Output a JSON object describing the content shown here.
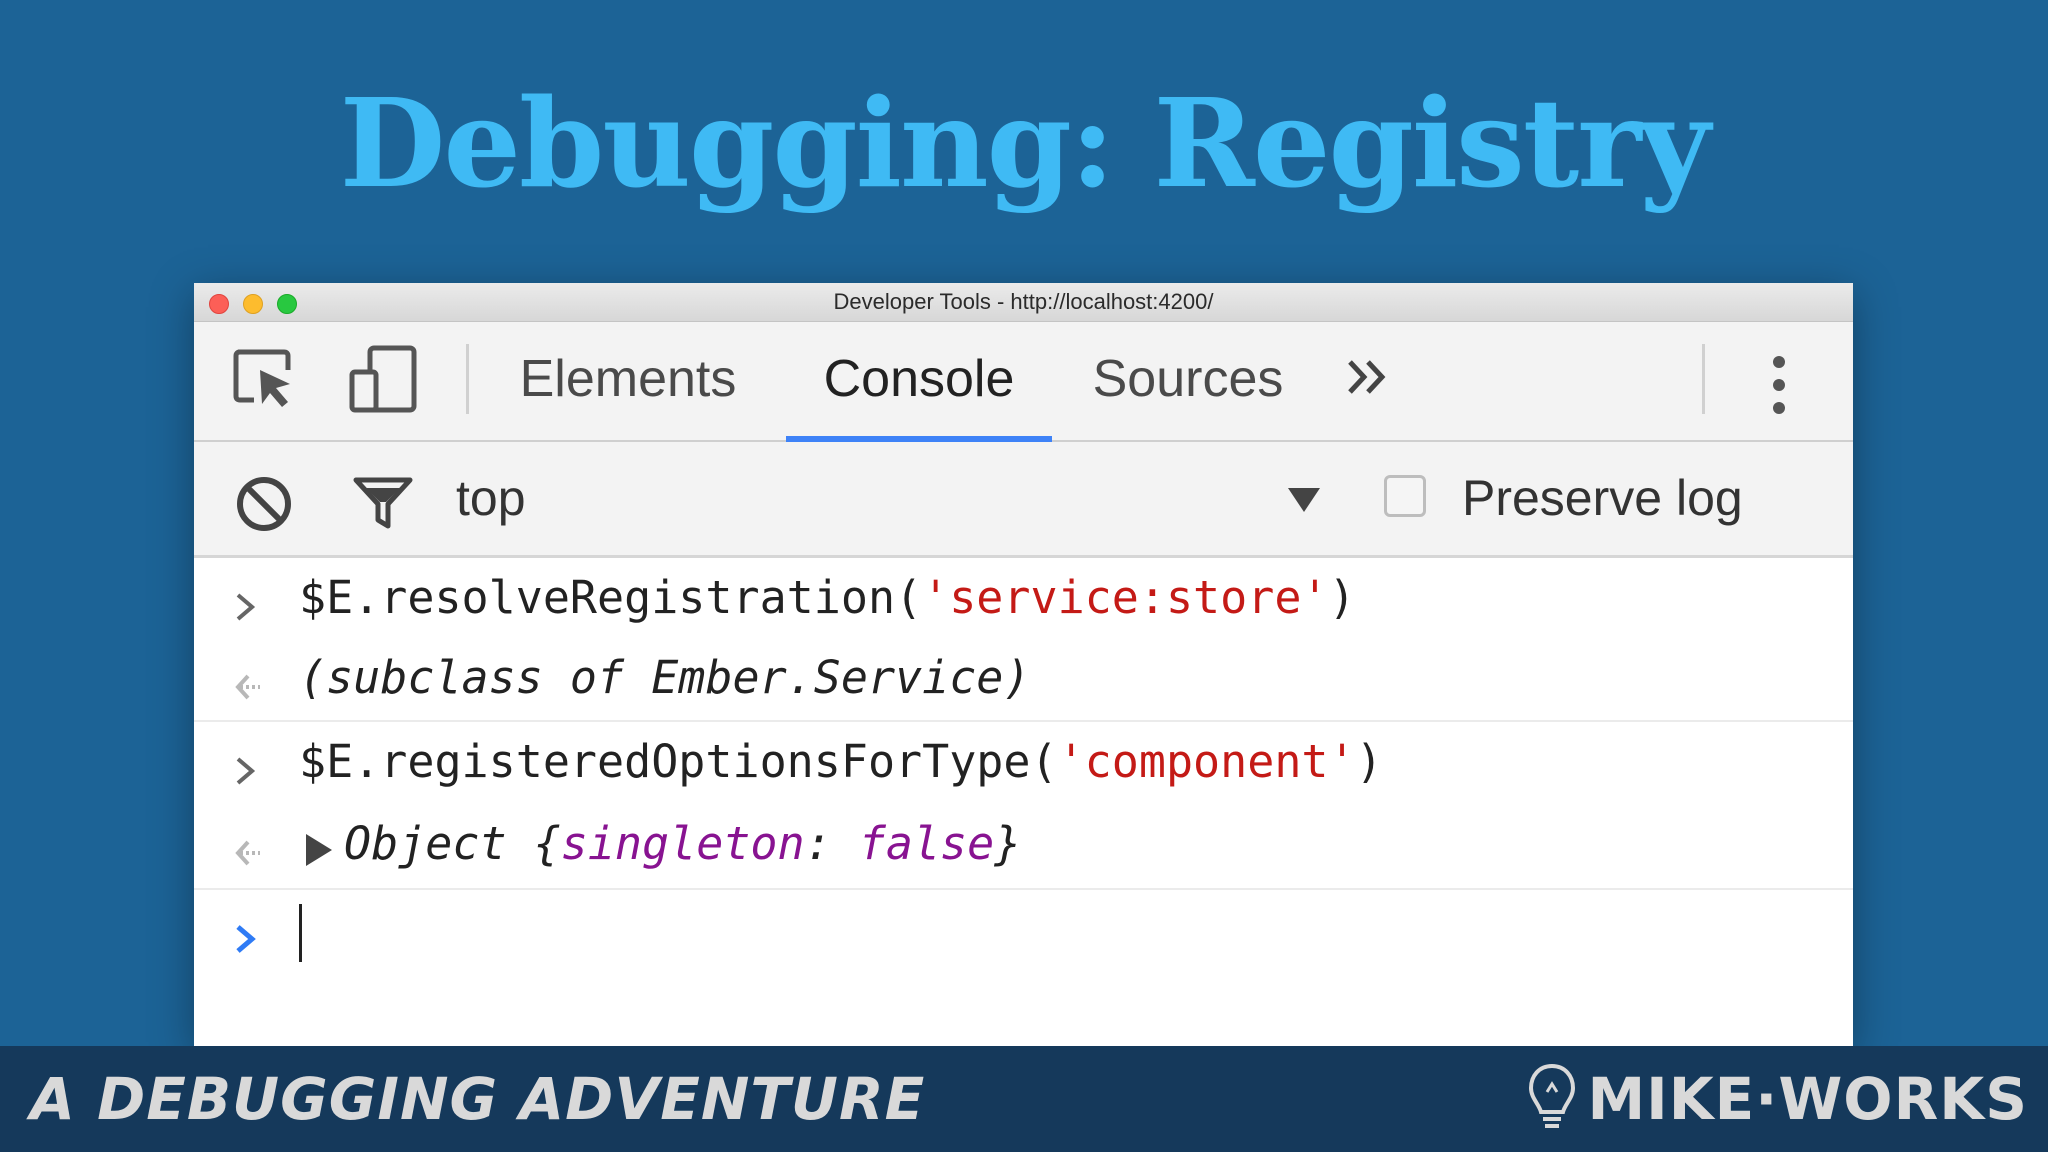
{
  "slide": {
    "title": "Debugging: Registry"
  },
  "window": {
    "title": "Developer Tools - http://localhost:4200/"
  },
  "tabs": [
    {
      "label": "Elements",
      "active": false
    },
    {
      "label": "Console",
      "active": true
    },
    {
      "label": "Sources",
      "active": false
    }
  ],
  "toolbar": {
    "context": "top",
    "preserve_log_label": "Preserve log",
    "preserve_log_checked": false
  },
  "console": {
    "entries": [
      {
        "type": "input",
        "fn": "$E.resolveRegistration(",
        "arg": "'service:store'",
        "close": ")"
      },
      {
        "type": "output",
        "text": "(subclass of Ember.Service)"
      },
      {
        "type": "input",
        "fn": "$E.registeredOptionsForType(",
        "arg": "'component'",
        "close": ")"
      },
      {
        "type": "output",
        "obj_prefix": "Object {",
        "key": "singleton",
        "sep": ": ",
        "value": "false",
        "obj_suffix": "}"
      }
    ]
  },
  "footer": {
    "title": "A DEBUGGING ADVENTURE",
    "brand": "MIKE·WORKS"
  },
  "colors": {
    "background": "#1c6396",
    "title": "#3fbaf4",
    "accent_tab": "#3e82f7",
    "string": "#c41a16",
    "property": "#881391"
  },
  "icons": [
    "inspect-icon",
    "device-toolbar-icon",
    "more-tabs-icon",
    "kebab-menu-icon",
    "clear-console-icon",
    "filter-icon",
    "dropdown-arrow-icon",
    "chevron-right-icon",
    "return-arrow-icon",
    "expand-triangle-icon",
    "lightbulb-icon"
  ]
}
